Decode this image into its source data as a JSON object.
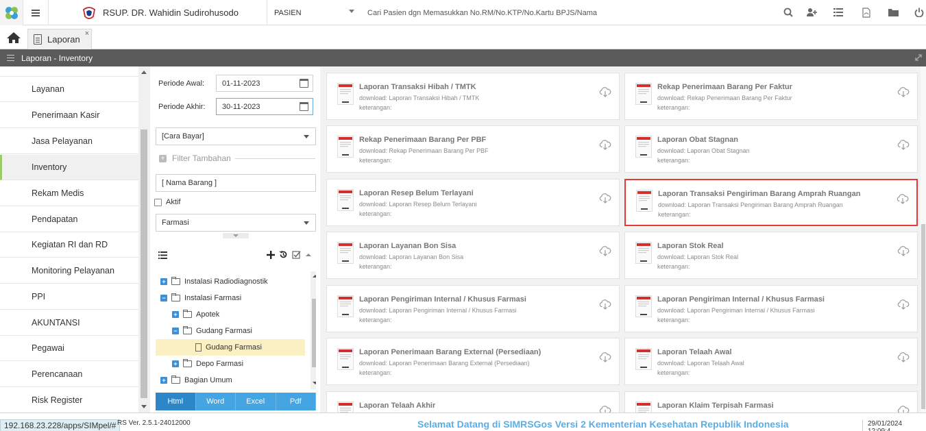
{
  "header": {
    "hospital_name": "RSUP. DR. Wahidin Sudirohusodo",
    "patient_mode": "PASIEN",
    "patient_search_placeholder": "Cari Pasien dgn Memasukkan No.RM/No.KTP/No.Kartu BPJS/Nama",
    "icons": [
      "search-icon",
      "add-user-icon",
      "list-icon",
      "pdf-icon",
      "folder-icon",
      "power-icon"
    ]
  },
  "tabs": [
    {
      "label": "Laporan",
      "close": "×"
    }
  ],
  "section_title": "Laporan - Inventory",
  "sidebar": {
    "items": [
      {
        "label": "Layanan"
      },
      {
        "label": "Penerimaan Kasir"
      },
      {
        "label": "Jasa Pelayanan"
      },
      {
        "label": "Inventory",
        "active": true
      },
      {
        "label": "Rekam Medis"
      },
      {
        "label": "Pendapatan"
      },
      {
        "label": "Kegiatan RI dan RD"
      },
      {
        "label": "Monitoring Pelayanan"
      },
      {
        "label": "PPI"
      },
      {
        "label": "AKUNTANSI"
      },
      {
        "label": "Pegawai"
      },
      {
        "label": "Perencanaan"
      },
      {
        "label": "Risk Register"
      }
    ]
  },
  "filters": {
    "periode_awal_label": "Periode Awal:",
    "periode_awal_value": "01-11-2023",
    "periode_akhir_label": "Periode Akhir:",
    "periode_akhir_value": "30-11-2023",
    "cara_bayar": "[Cara Bayar]",
    "filter_tambahan": "Filter Tambahan",
    "nama_barang_placeholder": "[ Nama Barang ]",
    "aktif_label": "Aktif",
    "unit": "Farmasi"
  },
  "tree": {
    "items": [
      {
        "label": "Instalasi Radiodiagnostik",
        "toggle": "+",
        "open": false
      },
      {
        "label": "Instalasi Farmasi",
        "toggle": "−",
        "open": true
      },
      {
        "label": "Apotek",
        "toggle": "+",
        "open": false
      },
      {
        "label": "Gudang Farmasi",
        "toggle": "−",
        "open": true
      },
      {
        "label": "Gudang Farmasi",
        "toggle": "",
        "selected": true
      },
      {
        "label": "Depo Farmasi",
        "toggle": "+",
        "open": false
      },
      {
        "label": "Bagian Umum",
        "toggle": "+",
        "open": false
      }
    ]
  },
  "export": {
    "buttons": [
      "Html",
      "Word",
      "Excel",
      "Pdf"
    ],
    "active": "Html"
  },
  "reports": [
    {
      "title": "Laporan Transaksi Hibah / TMTK",
      "download": "download: Laporan Transaksi Hibah / TMTK",
      "note": "keterangan:"
    },
    {
      "title": "Rekap Penerimaan Barang Per Faktur",
      "download": "download: Rekap Penerimaan Barang Per Faktur",
      "note": "keterangan:"
    },
    {
      "title": "Rekap Penerimaan Barang Per PBF",
      "download": "download: Rekap Penerimaan Barang Per PBF",
      "note": "keterangan:"
    },
    {
      "title": "Laporan Obat Stagnan",
      "download": "download: Laporan Obat Stagnan",
      "note": "keterangan:"
    },
    {
      "title": "Laporan Resep Belum Terlayani",
      "download": "download: Laporan Resep Belum Terlayani",
      "note": "keterangan:"
    },
    {
      "title": "Laporan Transaksi Pengiriman Barang Amprah Ruangan",
      "download": "download: Laporan Transaksi Pengiriman Barang Amprah Ruangan",
      "note": "keterangan:",
      "highlight": true
    },
    {
      "title": "Laporan Layanan Bon Sisa",
      "download": "download: Laporan Layanan Bon Sisa",
      "note": "keterangan:"
    },
    {
      "title": "Laporan Stok Real",
      "download": "download: Laporan Stok Real",
      "note": "keterangan:"
    },
    {
      "title": "Laporan Pengiriman Internal / Khusus Farmasi",
      "download": "download: Laporan Pengiriman Internal / Khusus Farmasi",
      "note": "keterangan:"
    },
    {
      "title": "Laporan Pengiriman Internal / Khusus Farmasi",
      "download": "download: Laporan Pengiriman Internal / Khusus Farmasi",
      "note": "keterangan:"
    },
    {
      "title": "Laporan Penerimaan Barang External (Persediaan)",
      "download": "download: Laporan Penerimaan Barang External (Persediaan)",
      "note": "keterangan:"
    },
    {
      "title": "Laporan Telaah Awal",
      "download": "download: Laporan Telaah Awal",
      "note": "keterangan:"
    },
    {
      "title": "Laporan Telaah Akhir",
      "download": "",
      "note": ""
    },
    {
      "title": "Laporan Klaim Terpisah Farmasi",
      "download": "",
      "note": ""
    }
  ],
  "status": {
    "url": "192.168.23.228/apps/SIMpel/#",
    "version": "RS Ver. 2.5.1-24012000",
    "welcome": "Selamat Datang di SIMRSGos Versi 2 Kementerian Kesehatan Republik Indonesia",
    "datetime": "29/01/2024 12:09:4"
  },
  "colors": {
    "accent": "#45a5e2",
    "section_bg": "#5a5a5a",
    "highlight_border": "#e53935",
    "selected_tree": "#fbefc4"
  }
}
